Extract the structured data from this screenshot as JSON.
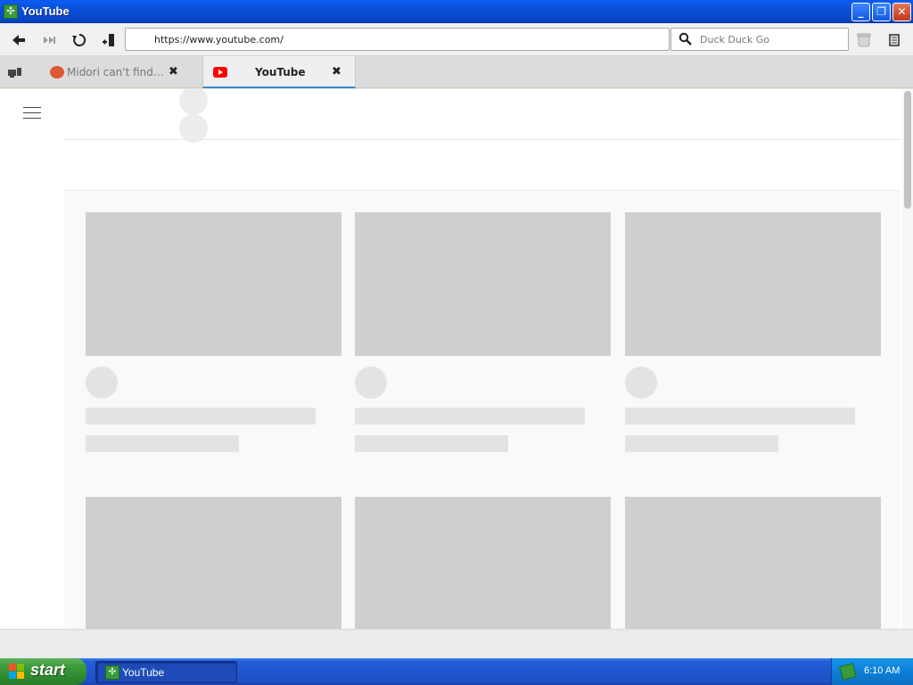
{
  "window": {
    "title": "YouTube",
    "buttons": {
      "minimize": "_",
      "maximize": "❐",
      "close": "✕"
    }
  },
  "toolbar": {
    "url": "https://www.youtube.com/",
    "search_placeholder": "Duck Duck Go"
  },
  "tabs": [
    {
      "label": "Midori can't find ...",
      "active": false,
      "favicon": "duckduckgo-icon"
    },
    {
      "label": "YouTube",
      "active": true,
      "favicon": "youtube-icon"
    }
  ],
  "taskbar": {
    "start_label": "start",
    "task_label": "YouTube",
    "clock": "6:10 AM"
  },
  "colors": {
    "titlebar": "#0a4fd8",
    "start": "#3c9b3c",
    "taskbar": "#245edb",
    "skeleton": "#cfcfcf",
    "youtube_red": "#ff0000",
    "tab_underline": "#3a88c8"
  }
}
